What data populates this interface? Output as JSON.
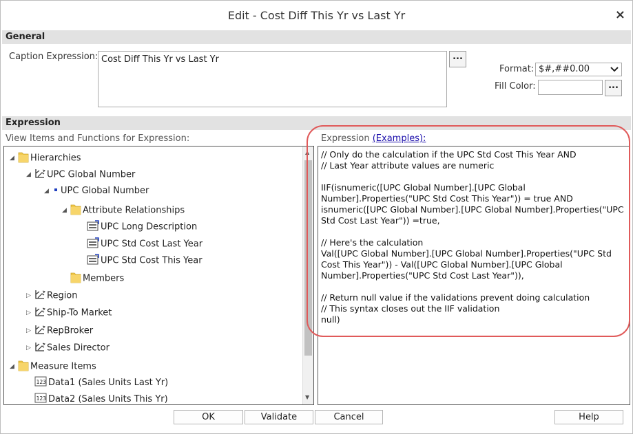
{
  "dialog": {
    "title": "Edit - Cost Diff This Yr vs Last Yr",
    "close_label": "×"
  },
  "general": {
    "header": "General",
    "caption_label": "Caption Expression:",
    "caption_value": "Cost Diff This Yr vs Last Yr",
    "dots_label": "...",
    "format_label": "Format:",
    "format_value": "$#,##0.00",
    "fill_label": "Fill Color:",
    "fill_value": ""
  },
  "expression": {
    "header": "Expression",
    "items_label": "View Items and Functions for Expression:",
    "expr_label": "Expression",
    "examples_link": "(Examples):",
    "text": "// Only do the calculation if the UPC Std Cost This Year AND\n// Last Year attribute values are numeric\n\nIIF(isnumeric([UPC Global Number].[UPC Global Number].Properties(\"UPC Std Cost This Year\")) = true AND isnumeric([UPC Global Number].[UPC Global Number].Properties(\"UPC Std Cost Last Year\")) =true,\n\n// Here's the calculation\nVal([UPC Global Number].[UPC Global Number].Properties(\"UPC Std Cost This Year\")) - Val([UPC Global Number].[UPC Global Number].Properties(\"UPC Std Cost Last Year\")),\n\n// Return null value if the validations prevent doing calculation\n// This syntax closes out the IIF validation\nnull)"
  },
  "tree": {
    "items": [
      {
        "label": "Hierarchies",
        "icon": "folder-icon",
        "twisty": "expanded"
      },
      {
        "label": "UPC Global Number",
        "icon": "hierarchy-icon",
        "twisty": "expanded"
      },
      {
        "label": "UPC Global Number",
        "icon": "level-dot-icon",
        "twisty": "expanded"
      },
      {
        "label": "Attribute Relationships",
        "icon": "folder-icon",
        "twisty": "expanded"
      },
      {
        "label": "UPC Long Description",
        "icon": "attribute-icon",
        "twisty": "none"
      },
      {
        "label": "UPC Std Cost Last Year",
        "icon": "attribute-icon",
        "twisty": "none"
      },
      {
        "label": "UPC Std Cost This Year",
        "icon": "attribute-icon",
        "twisty": "none"
      },
      {
        "label": "Members",
        "icon": "folder-icon",
        "twisty": "none"
      },
      {
        "label": "Region",
        "icon": "hierarchy-icon",
        "twisty": "collapsed"
      },
      {
        "label": "Ship-To Market",
        "icon": "hierarchy-icon",
        "twisty": "collapsed"
      },
      {
        "label": "RepBroker",
        "icon": "hierarchy-icon",
        "twisty": "collapsed"
      },
      {
        "label": "Sales Director",
        "icon": "hierarchy-icon",
        "twisty": "collapsed"
      },
      {
        "label": "Measure Items",
        "icon": "folder-icon",
        "twisty": "expanded"
      },
      {
        "label": "Data1 (Sales Units Last Yr)",
        "icon": "measure-icon",
        "twisty": "none"
      },
      {
        "label": "Data2 (Sales Units This Yr)",
        "icon": "measure-icon",
        "twisty": "none"
      }
    ]
  },
  "buttons": {
    "ok": "OK",
    "validate": "Validate",
    "cancel": "Cancel",
    "help": "Help"
  },
  "colors": {
    "highlight": "#e05a5a",
    "section_bg": "#e2e2e2",
    "folder": "#f2c94c",
    "link": "#1a0dab"
  }
}
